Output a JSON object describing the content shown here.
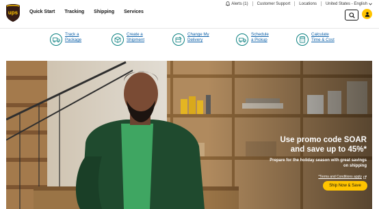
{
  "brand": {
    "logo_text": "ups",
    "colors": {
      "brown": "#351c15",
      "gold": "#ffc400",
      "teal": "#0a8080",
      "link": "#0a5fa8"
    }
  },
  "nav": {
    "items": [
      "Quick Start",
      "Tracking",
      "Shipping",
      "Services"
    ]
  },
  "utility": {
    "alerts": "Alerts (1)",
    "customer_support": "Customer Support",
    "locations": "Locations",
    "region": "United States - English"
  },
  "header_icons": {
    "search": "search-icon",
    "login": "user-icon"
  },
  "quick_actions": [
    {
      "line1": "Track a",
      "line2": "Package",
      "icon": "truck-package-icon"
    },
    {
      "line1": "Create a",
      "line2": "Shipment",
      "icon": "box-icon"
    },
    {
      "line1": "Change My",
      "line2": "Delivery",
      "icon": "package-edit-icon"
    },
    {
      "line1": "Schedule",
      "line2": "a Pickup",
      "icon": "pickup-truck-icon"
    },
    {
      "line1": "Calculate",
      "line2": "Time & Cost",
      "icon": "calculator-icon"
    }
  ],
  "hero": {
    "title_line1": "Use promo code SOAR",
    "title_line2": "and save up to 45%*",
    "subtitle_line1": "Prepare for the holiday season with great savings",
    "subtitle_line2": "on shipping",
    "terms": "*Terms and Conditions apply",
    "cta": "Ship Now & Save"
  }
}
